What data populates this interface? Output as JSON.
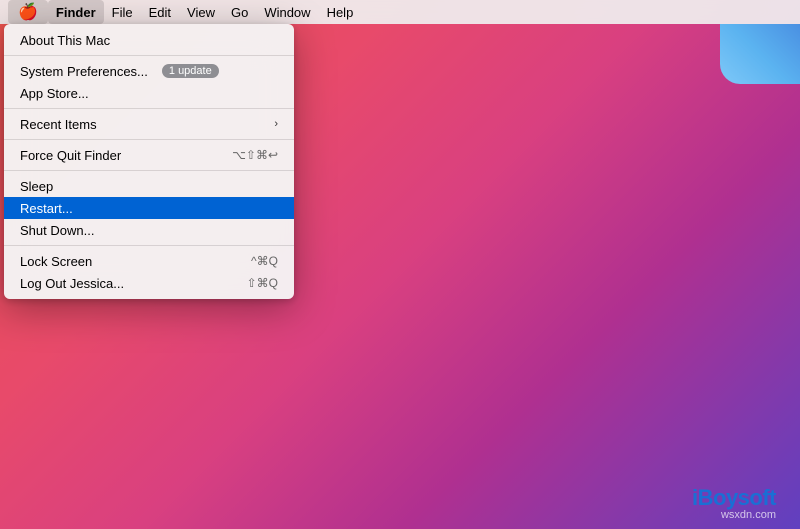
{
  "menubar": {
    "apple_symbol": "🍎",
    "items": [
      {
        "label": "Finder",
        "active": true
      },
      {
        "label": "File"
      },
      {
        "label": "Edit"
      },
      {
        "label": "View"
      },
      {
        "label": "Go"
      },
      {
        "label": "Window"
      },
      {
        "label": "Help"
      }
    ]
  },
  "dropdown": {
    "items": [
      {
        "id": "about",
        "label": "About This Mac",
        "shortcut": "",
        "type": "item"
      },
      {
        "id": "separator1",
        "type": "separator"
      },
      {
        "id": "system-prefs",
        "label": "System Preferences...",
        "badge": "1 update",
        "type": "item"
      },
      {
        "id": "app-store",
        "label": "App Store...",
        "type": "item"
      },
      {
        "id": "separator2",
        "type": "separator"
      },
      {
        "id": "recent-items",
        "label": "Recent Items",
        "chevron": "›",
        "type": "item"
      },
      {
        "id": "separator3",
        "type": "separator"
      },
      {
        "id": "force-quit",
        "label": "Force Quit Finder",
        "shortcut": "⌥⇧⌘↩",
        "type": "item"
      },
      {
        "id": "separator4",
        "type": "separator"
      },
      {
        "id": "sleep",
        "label": "Sleep",
        "type": "item"
      },
      {
        "id": "restart",
        "label": "Restart...",
        "type": "item",
        "highlighted": true
      },
      {
        "id": "shutdown",
        "label": "Shut Down...",
        "type": "item"
      },
      {
        "id": "separator5",
        "type": "separator"
      },
      {
        "id": "lock-screen",
        "label": "Lock Screen",
        "shortcut": "^⌘Q",
        "type": "item"
      },
      {
        "id": "logout",
        "label": "Log Out Jessica...",
        "shortcut": "⇧⌘Q",
        "type": "item"
      }
    ]
  },
  "watermark": {
    "text": "iBoysoft",
    "site": "wsxdn.com"
  }
}
